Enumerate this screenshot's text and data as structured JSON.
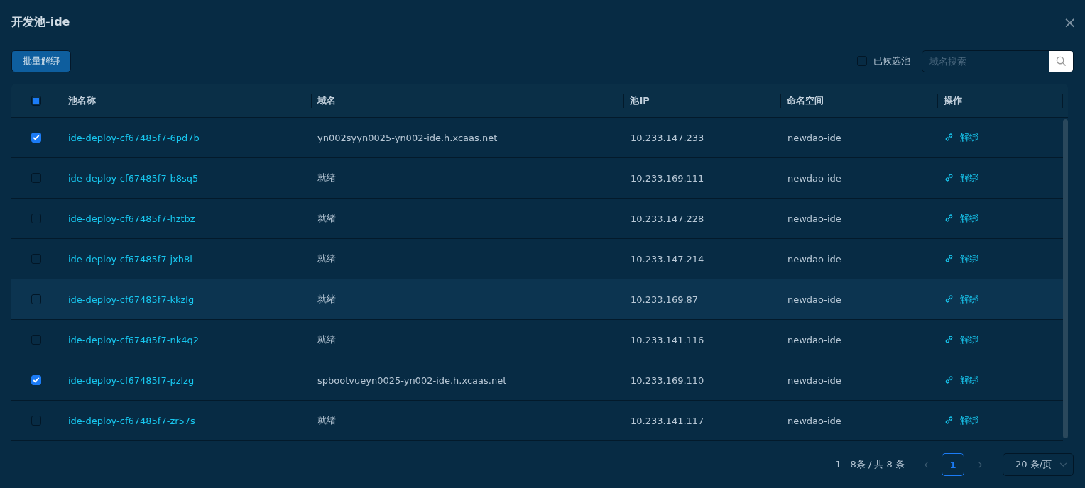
{
  "dialog": {
    "title": "开发池-ide",
    "close": "×"
  },
  "toolbar": {
    "batch_button": "批量解绑",
    "candidate_filter": {
      "label": "已候选池",
      "checked": false
    },
    "search": {
      "placeholder": "域名搜索"
    }
  },
  "table": {
    "select_all": {
      "checked": false,
      "indeterminate": true
    },
    "columns": [
      "池名称",
      "域名",
      "池IP",
      "命名空间",
      "操作"
    ],
    "rows": [
      {
        "checked": true,
        "hovered": false,
        "name": "ide-deploy-cf67485f7-6pd7b",
        "domain": "yn002syyn0025-yn002-ide.h.xcaas.net",
        "ip": "10.233.147.233",
        "namespace": "newdao-ide",
        "action": "解绑"
      },
      {
        "checked": false,
        "hovered": false,
        "name": "ide-deploy-cf67485f7-b8sq5",
        "domain": "就绪",
        "ip": "10.233.169.111",
        "namespace": "newdao-ide",
        "action": "解绑"
      },
      {
        "checked": false,
        "hovered": false,
        "name": "ide-deploy-cf67485f7-hztbz",
        "domain": "就绪",
        "ip": "10.233.147.228",
        "namespace": "newdao-ide",
        "action": "解绑"
      },
      {
        "checked": false,
        "hovered": false,
        "name": "ide-deploy-cf67485f7-jxh8l",
        "domain": "就绪",
        "ip": "10.233.147.214",
        "namespace": "newdao-ide",
        "action": "解绑"
      },
      {
        "checked": false,
        "hovered": true,
        "name": "ide-deploy-cf67485f7-kkzlg",
        "domain": "就绪",
        "ip": "10.233.169.87",
        "namespace": "newdao-ide",
        "action": "解绑"
      },
      {
        "checked": false,
        "hovered": false,
        "name": "ide-deploy-cf67485f7-nk4q2",
        "domain": "就绪",
        "ip": "10.233.141.116",
        "namespace": "newdao-ide",
        "action": "解绑"
      },
      {
        "checked": true,
        "hovered": false,
        "name": "ide-deploy-cf67485f7-pzlzg",
        "domain": "spbootvueyn0025-yn002-ide.h.xcaas.net",
        "ip": "10.233.169.110",
        "namespace": "newdao-ide",
        "action": "解绑"
      },
      {
        "checked": false,
        "hovered": false,
        "name": "ide-deploy-cf67485f7-zr57s",
        "domain": "就绪",
        "ip": "10.233.141.117",
        "namespace": "newdao-ide",
        "action": "解绑"
      }
    ]
  },
  "pagination": {
    "summary": "1 - 8条 / 共 8 条",
    "pages": [
      {
        "label": "1",
        "selected": true
      }
    ],
    "page_size": "20 条/页"
  }
}
